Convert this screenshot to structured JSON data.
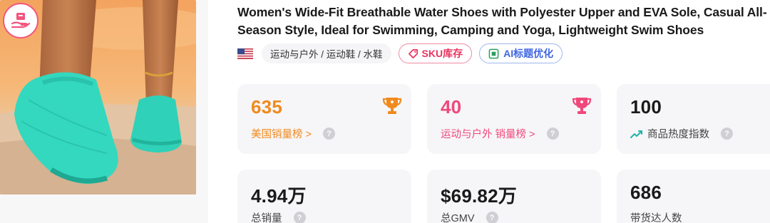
{
  "product": {
    "title": "Women's Wide-Fit Breathable Water Shoes with Polyester Upper and EVA Sole, Casual All-Season Style, Ideal for Swimming, Camping and Yoga, Lightweight Swim Shoes",
    "flag_icon": "us-flag-icon",
    "category": "运动与户外 / 运动鞋 / 水鞋",
    "sku_button": "SKU库存",
    "ai_button": "AI标题优化",
    "image_badge_icon": "hand-box-icon"
  },
  "stats": [
    {
      "value": "635",
      "label": "美国销量榜 >",
      "value_color": "#f08a1e",
      "icon": "trophy-icon"
    },
    {
      "value": "40",
      "label": "运动与户外 销量榜 >",
      "value_color": "#f0487a",
      "icon": "trophy-icon"
    },
    {
      "value": "100",
      "label": "商品热度指数",
      "value_color": "#1a1a1a",
      "icon": "trend-up-icon"
    },
    {
      "value": "4.94万",
      "label": "总销量",
      "value_color": "#1a1a1a"
    },
    {
      "value": "$69.82万",
      "label": "总GMV",
      "value_color": "#1a1a1a"
    },
    {
      "value": "686",
      "label": "带货达人数",
      "value_color": "#1a1a1a"
    }
  ],
  "help_glyph": "?",
  "colors": {
    "accent_orange": "#f08a1e",
    "accent_pink": "#f0487a",
    "accent_blue": "#3f66e0",
    "card_bg": "#f6f6f8"
  }
}
